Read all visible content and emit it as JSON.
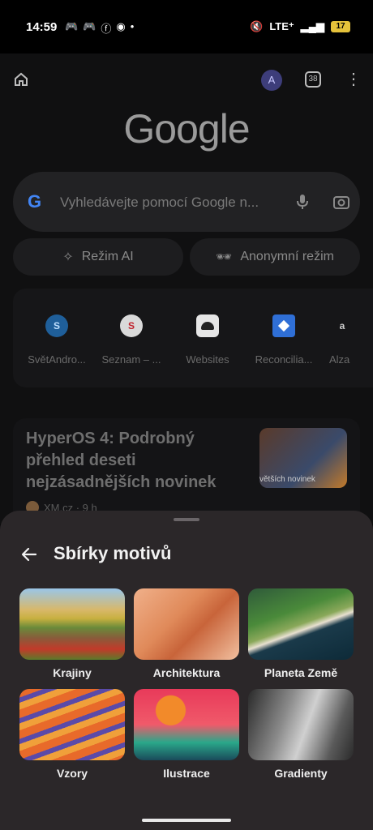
{
  "status": {
    "time": "14:59",
    "network": "LTE⁺",
    "battery": "17"
  },
  "topbar": {
    "avatar_letter": "A",
    "tab_count": "38"
  },
  "logo": "Google",
  "search": {
    "placeholder": "Vyhledávejte pomocí Google n..."
  },
  "pills": {
    "ai": "Režim AI",
    "anon": "Anonymní režim"
  },
  "shortcuts": [
    {
      "label": "SvětAndro...",
      "icon_text": "S"
    },
    {
      "label": "Seznam – ...",
      "icon_text": "S"
    },
    {
      "label": "Websites",
      "icon_text": ""
    },
    {
      "label": "Reconcilia...",
      "icon_text": ""
    },
    {
      "label": "Alza",
      "icon_text": "a"
    }
  ],
  "news": {
    "title": "HyperOS 4: Podrobný přehled deseti nejzásadnějších novinek",
    "source": "XM.cz · 9 h",
    "thumb_text": "větších novinek"
  },
  "sheet": {
    "title": "Sbírky motivů",
    "items": [
      {
        "label": "Krajiny"
      },
      {
        "label": "Architektura"
      },
      {
        "label": "Planeta Země"
      },
      {
        "label": "Vzory"
      },
      {
        "label": "Ilustrace"
      },
      {
        "label": "Gradienty"
      }
    ]
  }
}
